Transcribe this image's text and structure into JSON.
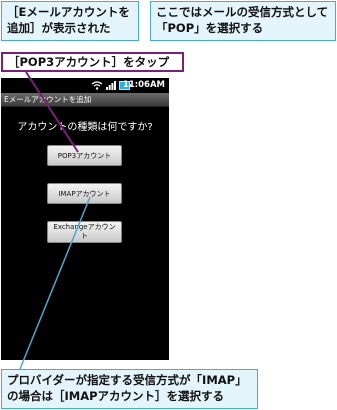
{
  "callouts": {
    "top_left": "［Eメールアカウントを追加］が表示された",
    "top_right": "ここではメールの受信方式として「POP」を選択する",
    "step": "［POP3アカウント］をタップ",
    "bottom": "プロバイダーが指定する受信方式が「IMAP」の場合は［IMAPアカウント］を選択する"
  },
  "phone": {
    "status": {
      "time": "11:06AM",
      "icons": [
        "wifi-icon",
        "signal-icon",
        "battery-icon"
      ]
    },
    "title": "Eメールアカウントを追加",
    "question": "アカウントの種類は何ですか?",
    "buttons": {
      "pop3": "POP3アカウント",
      "imap": "IMAPアカウント",
      "exchange": "Exchangeアカウント"
    }
  },
  "colors": {
    "callout_bg": "#e3f4fb",
    "callout_border": "#4aa9cf",
    "step_border": "#7d1f7a",
    "leader_pop": "#7d1f7a",
    "leader_imap": "#4aa9cf"
  }
}
